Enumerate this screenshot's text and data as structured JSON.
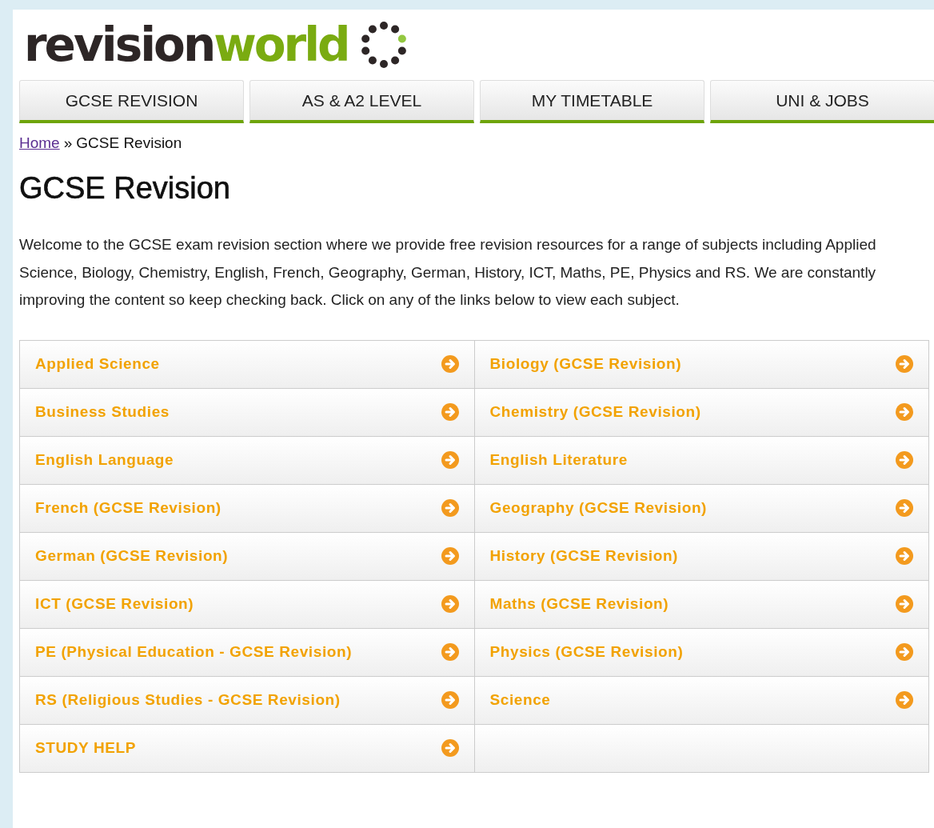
{
  "logo": {
    "part_1": "revision",
    "part_2": "world"
  },
  "tabs": [
    {
      "label": "GCSE REVISION"
    },
    {
      "label": "AS & A2 LEVEL"
    },
    {
      "label": "MY TIMETABLE"
    },
    {
      "label": "UNI & JOBS"
    }
  ],
  "breadcrumb": {
    "link": "Home",
    "separator": "»",
    "current": "GCSE Revision"
  },
  "heading": "GCSE Revision",
  "intro": "Welcome to the GCSE exam revision section where we provide free revision resources for a range of subjects including Applied Science, Biology, Chemistry, English, French, Geography, German, History, ICT, Maths, PE, Physics and RS. We are constantly improving the content so keep checking back. Click on any of the links below to view each subject.",
  "subjects": [
    {
      "label": "Applied Science"
    },
    {
      "label": "Biology (GCSE Revision)"
    },
    {
      "label": "Business Studies"
    },
    {
      "label": "Chemistry (GCSE Revision)"
    },
    {
      "label": "English Language"
    },
    {
      "label": "English Literature"
    },
    {
      "label": "French (GCSE Revision)"
    },
    {
      "label": "Geography (GCSE Revision)"
    },
    {
      "label": "German (GCSE Revision)"
    },
    {
      "label": "History (GCSE Revision)"
    },
    {
      "label": "ICT (GCSE Revision)"
    },
    {
      "label": "Maths (GCSE Revision)"
    },
    {
      "label": "PE (Physical Education - GCSE Revision)"
    },
    {
      "label": "Physics (GCSE Revision)"
    },
    {
      "label": "RS (Religious Studies - GCSE Revision)"
    },
    {
      "label": "Science"
    },
    {
      "label": "STUDY HELP"
    }
  ]
}
